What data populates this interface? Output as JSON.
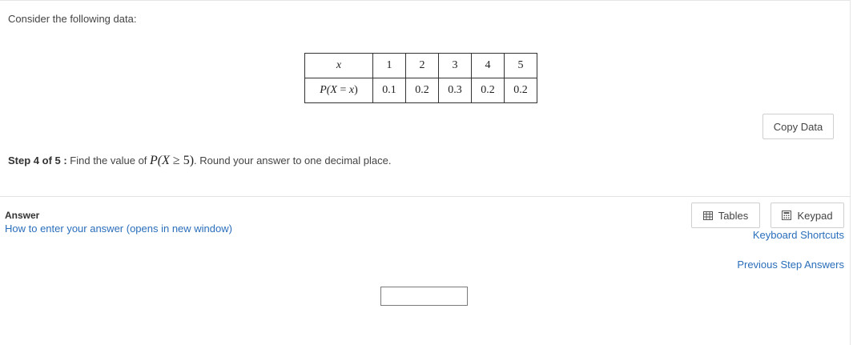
{
  "intro_text": "Consider the following data:",
  "table": {
    "header_x": "x",
    "x_values": [
      "1",
      "2",
      "3",
      "4",
      "5"
    ],
    "prob_label": {
      "p": "P(",
      "X": "X",
      "eq": " = ",
      "x": "x",
      "close": ")"
    },
    "probabilities": [
      "0.1",
      "0.2",
      "0.3",
      "0.2",
      "0.2"
    ]
  },
  "copy_button": "Copy Data",
  "step": {
    "label": "Step 4 of 5 :",
    "text_before": " Find the value of ",
    "math": {
      "p": "P(",
      "X": "X",
      "rest": " ≥ 5)"
    },
    "text_after": ". Round your answer to one decimal place."
  },
  "answer": {
    "label": "Answer",
    "help_link": "How to enter your answer (opens in new window)",
    "input_value": ""
  },
  "toolbar": {
    "tables_label": "Tables",
    "tables_icon": "table-icon",
    "keypad_label": "Keypad",
    "keypad_icon": "calculator-icon",
    "keyboard_shortcuts": "Keyboard Shortcuts",
    "previous_step_answers": "Previous Step Answers"
  },
  "colors": {
    "link": "#2a6ebb",
    "text": "#444444",
    "border": "#cfcfcf"
  }
}
